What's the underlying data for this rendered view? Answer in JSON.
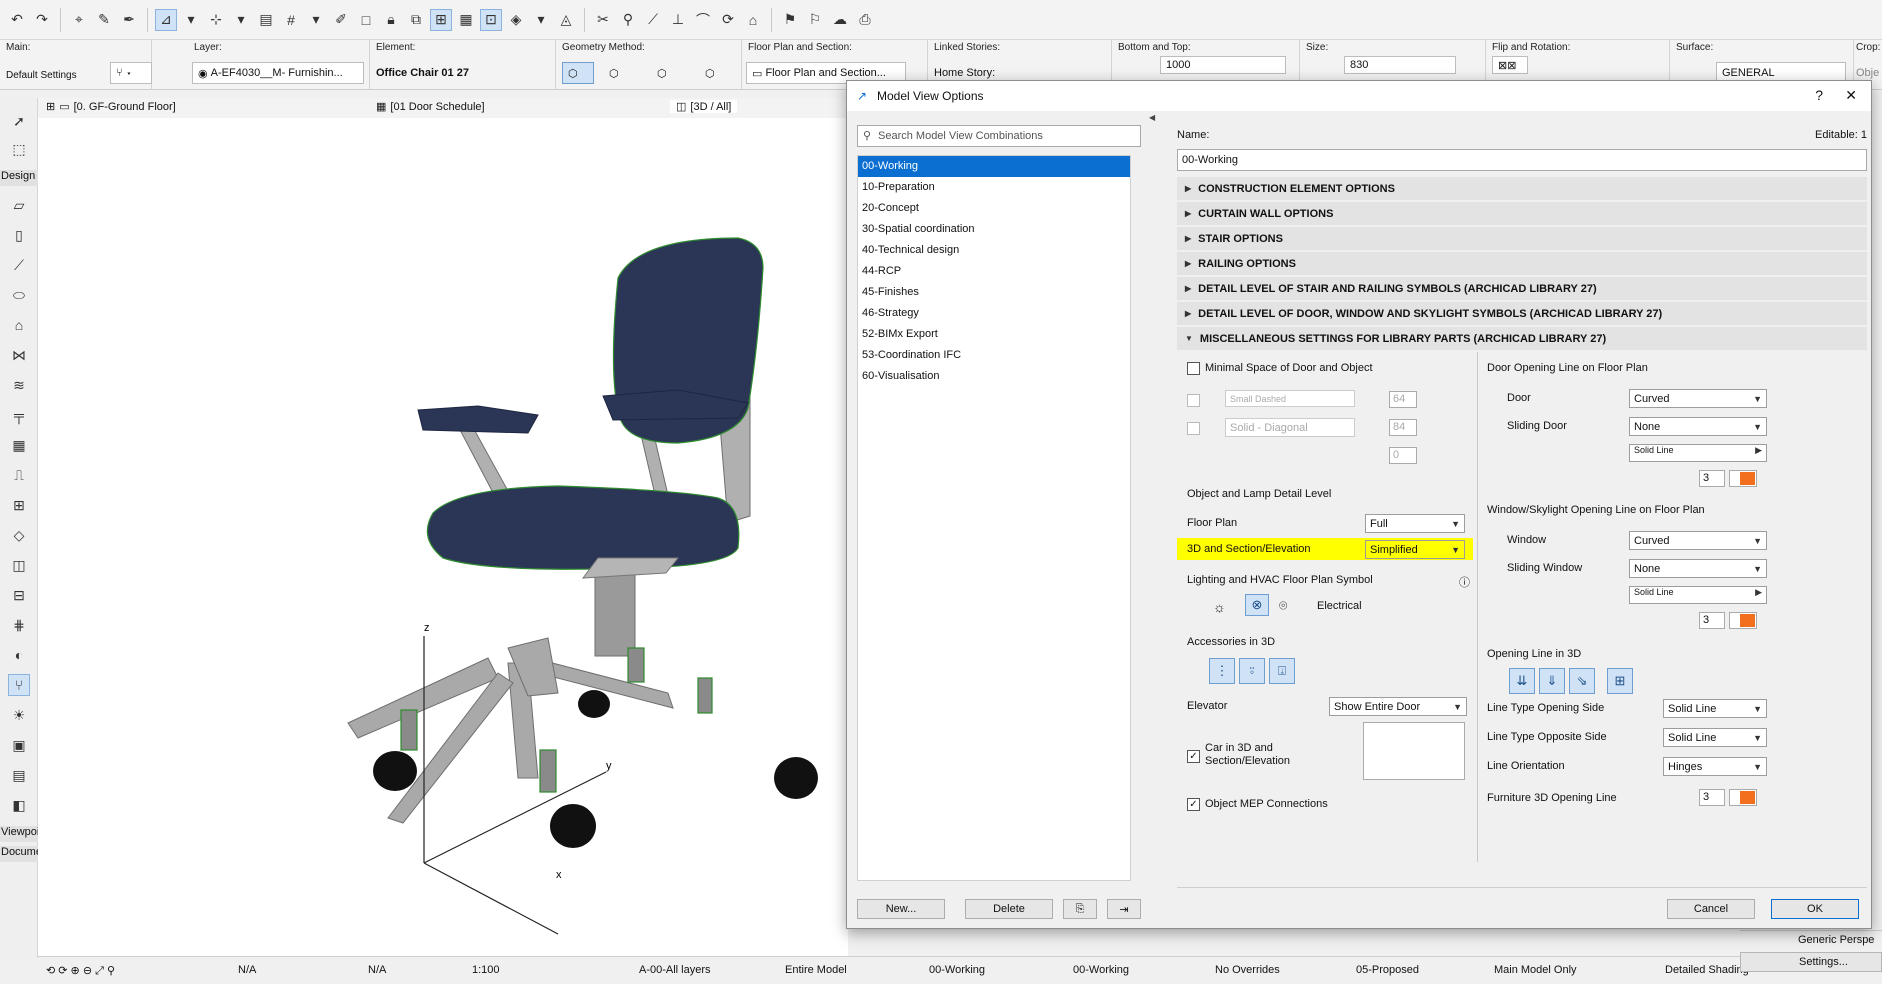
{
  "infobox": {
    "main_label": "Main:",
    "main_value": "Default Settings",
    "layer_label": "Layer:",
    "layer_value": "A-EF4030__M- Furnishin...",
    "element_label": "Element:",
    "element_value": "Office Chair 01 27",
    "geometry_label": "Geometry Method:",
    "floorplan_label": "Floor Plan and Section:",
    "floorplan_value": "Floor Plan and Section...",
    "linked_label": "Linked Stories:",
    "linked_value": "Home Story:",
    "bottom_top_label": "Bottom and Top:",
    "bottom_top_value": "1000",
    "size_label": "Size:",
    "size_value": "830",
    "flip_label": "Flip and Rotation:",
    "surface_label": "Surface:",
    "surface_value": "GENERAL",
    "crop_label": "Crop:",
    "obj_label": "Obje"
  },
  "tabs": [
    {
      "label": "[0. GF-Ground Floor]"
    },
    {
      "label": "[01 Door Schedule]"
    },
    {
      "label": "[3D / All]"
    }
  ],
  "toolbox": {
    "design_label": "Design",
    "viewpoint_label": "Viewpoi",
    "document_label": "Docume"
  },
  "axes": {
    "z": "z",
    "y": "y",
    "x": "x"
  },
  "dialog": {
    "title": "Model View Options",
    "help": "?",
    "close": "✕",
    "search_placeholder": "Search Model View Combinations",
    "list": [
      "00-Working",
      "10-Preparation",
      "20-Concept",
      "30-Spatial coordination",
      "40-Technical design",
      "44-RCP",
      "45-Finishes",
      "46-Strategy",
      "52-BIMx Export",
      "53-Coordination IFC",
      "60-Visualisation"
    ],
    "new_btn": "New...",
    "delete_btn": "Delete",
    "name_label": "Name:",
    "editable_label": "Editable: 1",
    "name_value": "00-Working",
    "sections": [
      "CONSTRUCTION ELEMENT OPTIONS",
      "CURTAIN WALL OPTIONS",
      "STAIR OPTIONS",
      "RAILING OPTIONS",
      "DETAIL LEVEL OF STAIR AND RAILING SYMBOLS (ARCHICAD LIBRARY 27)",
      "DETAIL LEVEL OF DOOR, WINDOW AND SKYLIGHT SYMBOLS (ARCHICAD LIBRARY 27)",
      "MISCELLANEOUS SETTINGS FOR LIBRARY PARTS (ARCHICAD LIBRARY 27)"
    ],
    "misc": {
      "minimal_space": "Minimal Space of Door and Object",
      "small_dashed": "Small Dashed",
      "solid_diagonal": "Solid - Diagonal",
      "pen64a": "64",
      "pen84": "84",
      "pen0": "0",
      "detail_level": "Object and Lamp Detail Level",
      "floor_plan": "Floor Plan",
      "floor_plan_value": "Full",
      "three_d": "3D and Section/Elevation",
      "three_d_value": "Simplified",
      "lighting": "Lighting and HVAC Floor Plan Symbol",
      "electrical": "Electrical",
      "accessories": "Accessories in 3D",
      "elevator": "Elevator",
      "elevator_value": "Show Entire Door",
      "car": "Car in 3D and\nSection/Elevation",
      "mep": "Object MEP Connections",
      "door_opening": "Door Opening Line on Floor Plan",
      "door": "Door",
      "door_value": "Curved",
      "sliding_door": "Sliding Door",
      "sliding_door_value": "None",
      "solid_line": "Solid Line",
      "pen3": "3",
      "window_opening": "Window/Skylight Opening Line on Floor Plan",
      "window": "Window",
      "window_value": "Curved",
      "sliding_window": "Sliding Window",
      "sliding_window_value": "None",
      "opening_3d": "Opening Line in 3D",
      "lt_open": "Line Type Opening Side",
      "lt_open_value": "Solid Line",
      "lt_opp": "Line Type Opposite Side",
      "lt_opp_value": "Solid Line",
      "orientation": "Line Orientation",
      "orientation_value": "Hinges",
      "furn": "Furniture 3D Opening Line"
    },
    "cancel_btn": "Cancel",
    "ok_btn": "OK"
  },
  "right_panel": {
    "generic": "Generic Perspe",
    "settings": "Settings..."
  },
  "status": {
    "na1": "N/A",
    "na2": "N/A",
    "scale": "1:100",
    "layers": "A-00-All layers",
    "model": "Entire Model",
    "mvo1": "00-Working",
    "mvo2": "00-Working",
    "overrides": "No Overrides",
    "reno": "05-Proposed",
    "main_model": "Main Model Only",
    "shading": "Detailed Shading"
  },
  "colors": {
    "accent": "#0a6fd1",
    "highlight": "#ffff00",
    "pen": "#f36f1e",
    "fabric": "#2b3656"
  }
}
